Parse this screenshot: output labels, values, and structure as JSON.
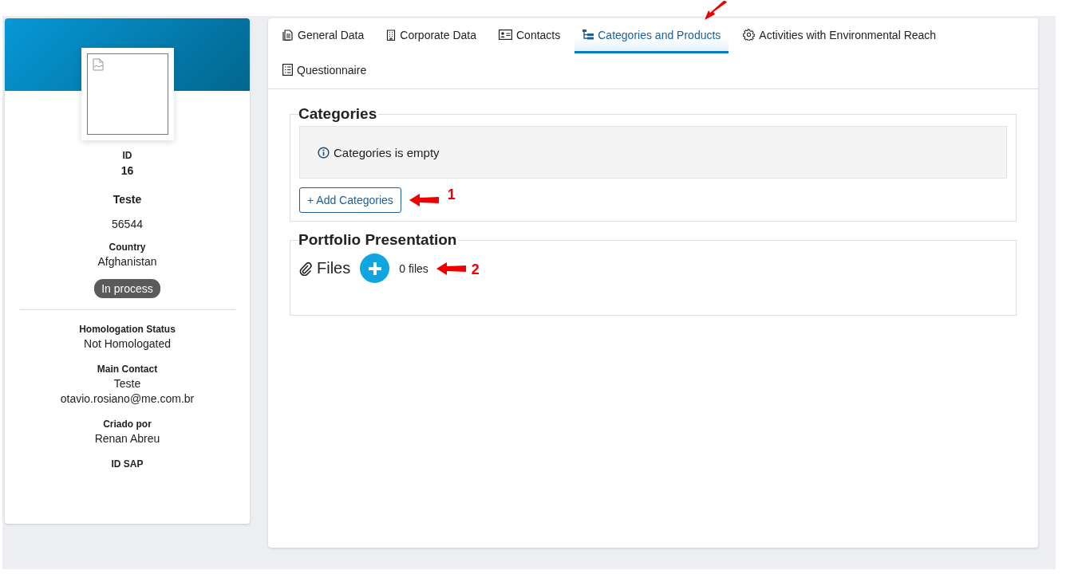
{
  "profile": {
    "id_label": "ID",
    "id": "16",
    "name": "Teste",
    "code": "56544",
    "country_label": "Country",
    "country": "Afghanistan",
    "status": "In process",
    "fields": [
      {
        "label": "Homologation Status",
        "values": [
          "Not Homologated"
        ]
      },
      {
        "label": "Main Contact",
        "values": [
          "Teste",
          "otavio.rosiano@me.com.br"
        ]
      },
      {
        "label": "Criado por",
        "values": [
          "Renan Abreu"
        ]
      },
      {
        "label": "ID SAP"
      }
    ]
  },
  "tabs": [
    {
      "label": "General Data",
      "kind": "document",
      "selected": false,
      "callout": false
    },
    {
      "label": "Corporate Data",
      "kind": "building",
      "selected": false,
      "callout": false
    },
    {
      "label": "Contacts",
      "kind": "card",
      "selected": false,
      "callout": false
    },
    {
      "label": "Categories and Products",
      "kind": "tree",
      "selected": true,
      "callout": true
    },
    {
      "label": "Activities with Environmental Reach",
      "kind": "gear",
      "selected": false,
      "callout": false
    },
    {
      "label": "Questionnaire",
      "kind": "list",
      "selected": false,
      "callout": false
    }
  ],
  "categories": {
    "title": "Categories",
    "empty_message": "Categories is empty",
    "add_button": "+ Add Categories",
    "callout": "1"
  },
  "portfolio": {
    "title": "Portfolio Presentation",
    "files_label": "Files",
    "count": "0 files",
    "callout": "2"
  }
}
